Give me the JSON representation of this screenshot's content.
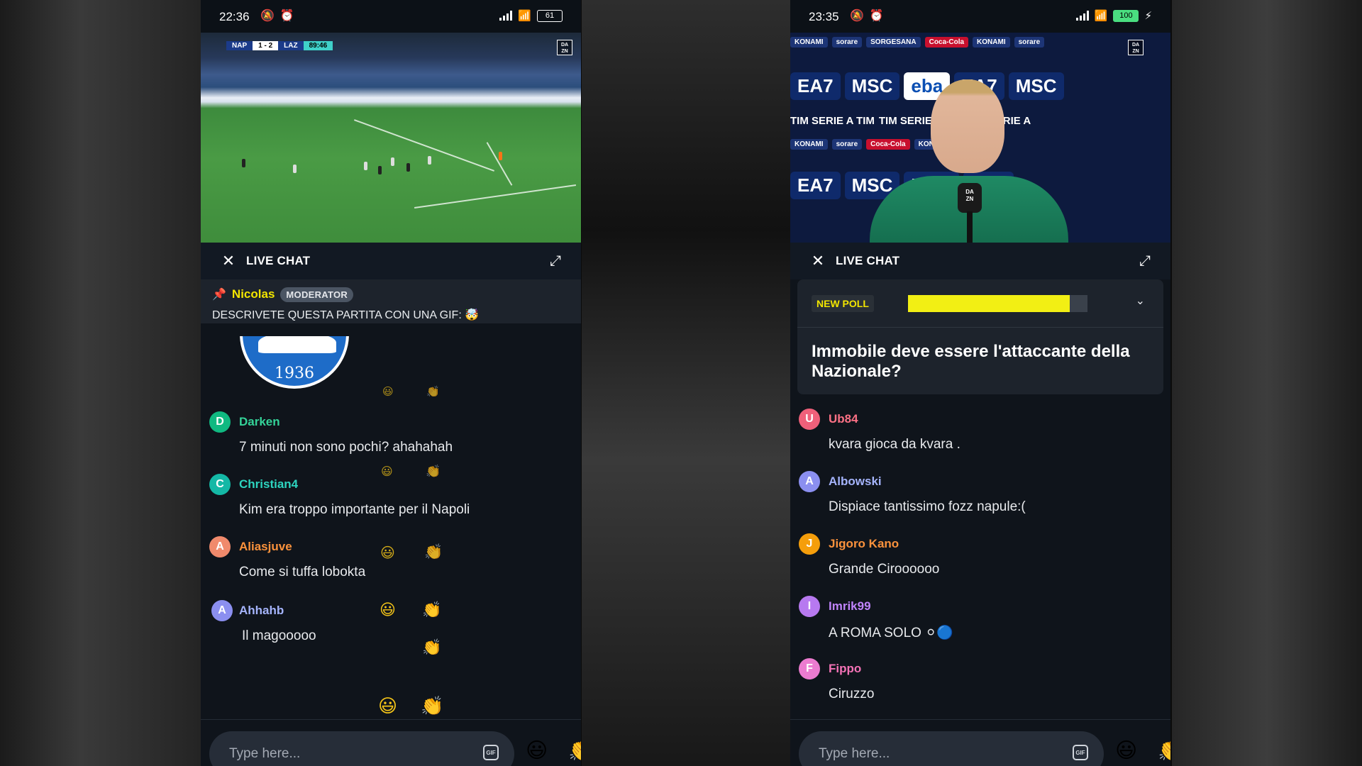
{
  "left": {
    "status": {
      "time": "22:36",
      "battery": "61"
    },
    "video": {
      "team1": "NAP",
      "score": "1 - 2",
      "team2": "LAZ",
      "clock": "89:46"
    },
    "chat_header": {
      "title": "LIVE CHAT"
    },
    "pinned": {
      "author": "Nicolas",
      "badge": "MODERATOR",
      "text": "DESCRIVETE QUESTA PARTITA CON UNA GIF: 🤯"
    },
    "gif_caption": "1936",
    "messages": [
      {
        "initial": "D",
        "name": "Darken",
        "text": "7 minuti non sono pochi? ahahahah",
        "color": "#34d399",
        "avatar_bg": "#10b981"
      },
      {
        "initial": "C",
        "name": "Christian4",
        "text": "Kim era troppo importante per il Napoli",
        "color": "#2dd4bf",
        "avatar_bg": "#14b8a6"
      },
      {
        "initial": "A",
        "name": "Aliasjuve",
        "text": "Come si tuffa lobokta",
        "color": "#fb923c",
        "avatar_bg": "#f08a6c"
      },
      {
        "initial": "A",
        "name": "Ahhahb",
        "text": "Il magooooo",
        "color": "#a5b4fc",
        "avatar_bg": "#8b8ff0"
      }
    ],
    "composer": {
      "placeholder": "Type here...",
      "gif_label": "GIF"
    }
  },
  "right": {
    "status": {
      "time": "23:35",
      "battery": "100"
    },
    "chat_header": {
      "title": "LIVE CHAT"
    },
    "poll": {
      "badge": "NEW POLL",
      "question": "Immobile deve essere l'attaccante della Nazionale?",
      "progress": 0.9
    },
    "messages": [
      {
        "initial": "U",
        "name": "Ub84",
        "text": "kvara gioca da kvara .",
        "color": "#fb7185",
        "avatar_bg": "#f0607a"
      },
      {
        "initial": "A",
        "name": "Albowski",
        "text": "Dispiace tantissimo fozz napule:(",
        "color": "#a5b4fc",
        "avatar_bg": "#8b8ff0"
      },
      {
        "initial": "J",
        "name": "Jigoro Kano",
        "text": "Grande Ciroooooo",
        "color": "#fb923c",
        "avatar_bg": "#f59e0b"
      },
      {
        "initial": "I",
        "name": "Imrik99",
        "text": "A ROMA SOLO ⚪🔵",
        "color": "#c084fc",
        "avatar_bg": "#b779f0"
      },
      {
        "initial": "F",
        "name": "Fippo",
        "text": "Ciruzzo",
        "color": "#f472b6",
        "avatar_bg": "#ec7bd0"
      }
    ],
    "composer": {
      "placeholder": "Type here...",
      "gif_label": "GIF"
    }
  },
  "icons": {
    "close": "close-icon",
    "expand": "expand-icon",
    "pin": "pin-icon",
    "chevron": "chevron-down-icon",
    "grin": "grinning-emoji-icon",
    "clap": "clapping-emoji-icon"
  }
}
